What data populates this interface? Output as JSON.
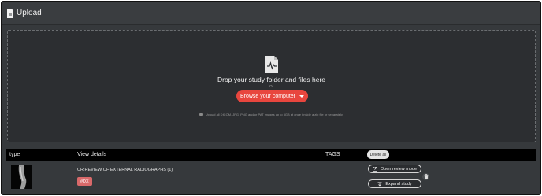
{
  "header": {
    "title": "Upload",
    "icon": "document-icon"
  },
  "dropzone": {
    "title": "Drop your study folder and files here",
    "or_text": "Or",
    "browse_label": "Browse your computer",
    "note": "Upload all DICOM, JPG, PNG and/or PAT images up to 5GB at once (inside a zip file or separately)"
  },
  "table": {
    "col_type": "type",
    "col_details": "View details",
    "col_tags": "TAGS",
    "delete_all_label": "Delete all"
  },
  "rows": [
    {
      "study_title": "CR REVIEW OF EXTERNAL RADIOGRAPHS (1)",
      "tag": "#DX",
      "open_review_label": "Open review mode",
      "expand_label": "Expand study"
    }
  ],
  "colors": {
    "accent": "#e8463e",
    "tag": "#d9696a",
    "background": "#36393c"
  }
}
